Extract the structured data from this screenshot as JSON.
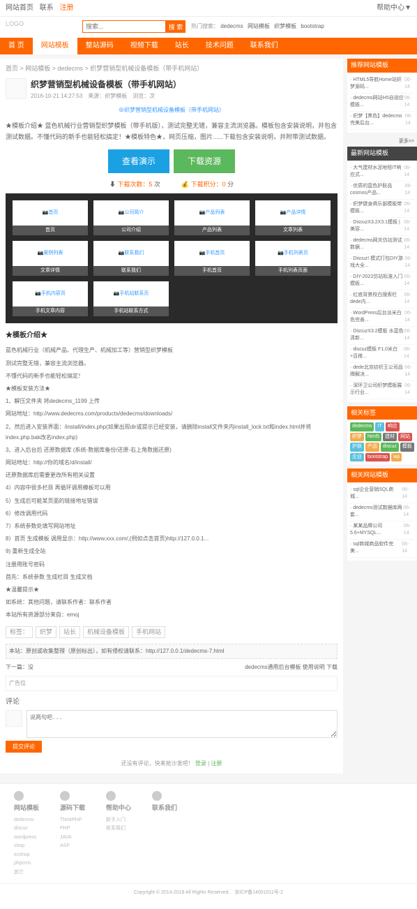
{
  "topbar": {
    "left": [
      "网站首页",
      "联系",
      "注册"
    ],
    "right": "帮助中心▼"
  },
  "search": {
    "placeholder": "搜索...",
    "btn": "搜 索"
  },
  "hotwords": {
    "label": "热门搜索：",
    "items": [
      "dedecms",
      "网站模板",
      "织梦模板",
      "bootstrap"
    ]
  },
  "nav": [
    "首 页",
    "网站模板",
    "整站源码",
    "视频下载",
    "站长",
    "技术问题",
    "联系我们"
  ],
  "breadcrumb": "首页 > 网站模板 > dedecms > 织梦营销型机械设备模板（带手机网站）",
  "article": {
    "title": "织梦营销型机械设备模板（带手机网站）",
    "date": "2016-10-21 14:27:53",
    "meta": "来源：织梦模板　浏览：次"
  },
  "previewLink": "⊕织梦营销型机械设备模板（带手机网站）",
  "desc": "★模板介绍★ 蓝色机械行业营销型织梦模板（带手机版），测试完整无错，兼容主流浏览器。模板包含安装说明，并包含测试数据。不懂代码的新手也能轻松搞定！★模板特色★，网页压缩，图片......下载包含安装说明，并附带测试数据。",
  "btns": {
    "demo": "查看演示",
    "down": "下载资源"
  },
  "stats": {
    "dl": "下载次数：",
    "dlv": "5",
    "pt": "下载积分：",
    "ptv": "0"
  },
  "thumbs": [
    {
      "img": "首页",
      "label": "首页"
    },
    {
      "img": "公司简介",
      "label": "公司介绍"
    },
    {
      "img": "产品列表",
      "label": "产品列表"
    },
    {
      "img": "产品详情",
      "label": "文章列表"
    },
    {
      "img": "案例列表",
      "label": "文章详情"
    },
    {
      "img": "联系我们",
      "label": "联系我们"
    },
    {
      "img": "手机首页",
      "label": "手机首页"
    },
    {
      "img": "手机列表页",
      "label": "手机列表页面"
    },
    {
      "img": "手机内容页",
      "label": "手机文章内容"
    },
    {
      "img": "手机站联系页",
      "label": "手机站联系方式"
    }
  ],
  "sec1": "★模板介绍★",
  "detail1": [
    "蓝色机械行业（机械产品、代理生产、机械加工等）营销型织梦模板",
    "测试完整无错，兼容主流浏览器。",
    "不懂代码的新手也能轻松搞定！",
    "★模板安装方法★",
    "1、解压文件夹 将dedecms_1199 上传",
    "网站地址：http://www.dedecms.com/products/dedecms/downloads/",
    "2、然后进入安装界面：/install/index.php(如果出现dir或提示已经安装，请删除install文件夹内install_lock.txt和index.html并将index.php.bak改名index.php)",
    "3、进入后台后 还原数据库 (系统-数据库备份/还原-右上角数据还原)",
    "网站地址：http://你的域名/d/install/",
    "还原数据库后需要更改所有相关设置",
    "4）内容中很多栏目 再循环调用模板可以用",
    "5）生成后可能某页面的链接地址错误",
    "6）修改调用代码",
    "7）系统参数处填写网站地址",
    "8）首页 生成模板 调用显示：http://www.xxx.com/,(例如点击首页)http://127.0.0.1...",
    "9) 重新生成全站",
    "注册用账号密码",
    "首先：系统参数 生成栏目 生成文档",
    "★温馨提示★",
    "如系统：其他问题，请联系作者：联系作者",
    "本站所有资源部分来自：emoj"
  ],
  "tagsRow": {
    "label": "标签：",
    "items": [
      "织梦",
      "站长",
      "机械设备模板",
      "手机网站"
    ]
  },
  "source": {
    "left": "本站：原创或收集整理（原创标出），如有侵权请联系：http://127.0.0.1/dedecms-7.html",
    "right": ""
  },
  "navLinks": {
    "prev": "下一篇：没",
    "next": "dedecms通用后台模板 使用说明 下载"
  },
  "ad": "广告位",
  "commentLabel": "评论",
  "commentPh": "说两句吧...",
  "submit": "提交评论",
  "commentFoot": "还没有评论，快来抢沙发吧！",
  "side1": {
    "title": "推荐网站模板",
    "items": [
      [
        "HTML5导航Home站织梦源码...",
        "06-14"
      ],
      [
        "dedecms网站H5自适应模板...",
        "06-14"
      ],
      [
        "织梦【黑色】dedecms完美后台...",
        "06-14"
      ]
    ]
  },
  "sideMore": "更多>>",
  "side2": {
    "title": "最新网站模板",
    "items": [
      [
        "大气建材水泥地毯IT响应式...",
        "06-14"
      ],
      [
        "优质的蓝色护肤品cosmos产品...",
        "06-14"
      ],
      [
        "织梦健身俱乐部模板带模板...",
        "06-14"
      ],
      [
        "DiscuzX3.2X3.1模板 | 美容...",
        "06-14"
      ],
      [
        "dedecms网关仿站测试数据...",
        "06-14"
      ],
      [
        "Discuz! 模式打包DIY游戏大全...",
        "06-14"
      ],
      [
        "DIY-2022仿站标准入门模板...",
        "06-14"
      ],
      [
        "红底背景校白搜索栏dede内...",
        "06-14"
      ],
      [
        "WordPress后台淡米白色完善...",
        "06-14"
      ],
      [
        "DiscuzX3.2模板 水蓝色清新...",
        "06-14"
      ],
      [
        "discuz模板 F1.0米白+百搭...",
        "06-14"
      ],
      [
        "dede北京纺织王公司品牌解决...",
        "06-14"
      ],
      [
        "深环卫公司织梦模板展示行业...",
        "06-14"
      ]
    ]
  },
  "tags": {
    "title": "相关标签",
    "items": [
      {
        "t": "dedecms",
        "c": "#5cb85c"
      },
      {
        "t": "IT",
        "c": "#5bc0de"
      },
      {
        "t": "响应",
        "c": "#d9534f"
      },
      {
        "t": "织梦",
        "c": "#f0ad4e"
      },
      {
        "t": "html5",
        "c": "#5cb85c"
      },
      {
        "t": "建材",
        "c": "#777"
      },
      {
        "t": "网站",
        "c": "#d9534f"
      },
      {
        "t": "护肤",
        "c": "#5bc0de"
      },
      {
        "t": "产品",
        "c": "#f0ad4e"
      },
      {
        "t": "discuz",
        "c": "#5cb85c"
      },
      {
        "t": "模板",
        "c": "#777"
      },
      {
        "t": "企业",
        "c": "#5bc0de"
      },
      {
        "t": "bootstrap",
        "c": "#d9534f"
      },
      {
        "t": "wp",
        "c": "#f0ad4e"
      }
    ]
  },
  "side3": {
    "title": "相关网站模板",
    "items": [
      [
        "sql企业营销SQL商城...",
        "06-14"
      ],
      [
        "dedecms测试数据库两套...",
        "06-14"
      ],
      [
        "某某品牌公司5.6+MYSQL...",
        "06-14"
      ],
      [
        "sql商城商品软件完美...",
        "06-14"
      ]
    ]
  },
  "footer": {
    "cols": [
      {
        "title": "网站模板",
        "links": [
          "dedecms",
          "discuz",
          "wordpress",
          "shop",
          "ecshop",
          "phpcms",
          "其它"
        ]
      },
      {
        "title": "源码下载",
        "links": [
          "ThinkPHP",
          "PHP",
          "JAVA",
          "ASP"
        ]
      },
      {
        "title": "帮助中心",
        "links": [
          "新手入门",
          "联系我们"
        ]
      },
      {
        "title": "联系我们",
        "links": []
      }
    ],
    "copyright": "Copyright © 2014-2018 All Rights Reserved.　京ICP备14001011号-2"
  }
}
